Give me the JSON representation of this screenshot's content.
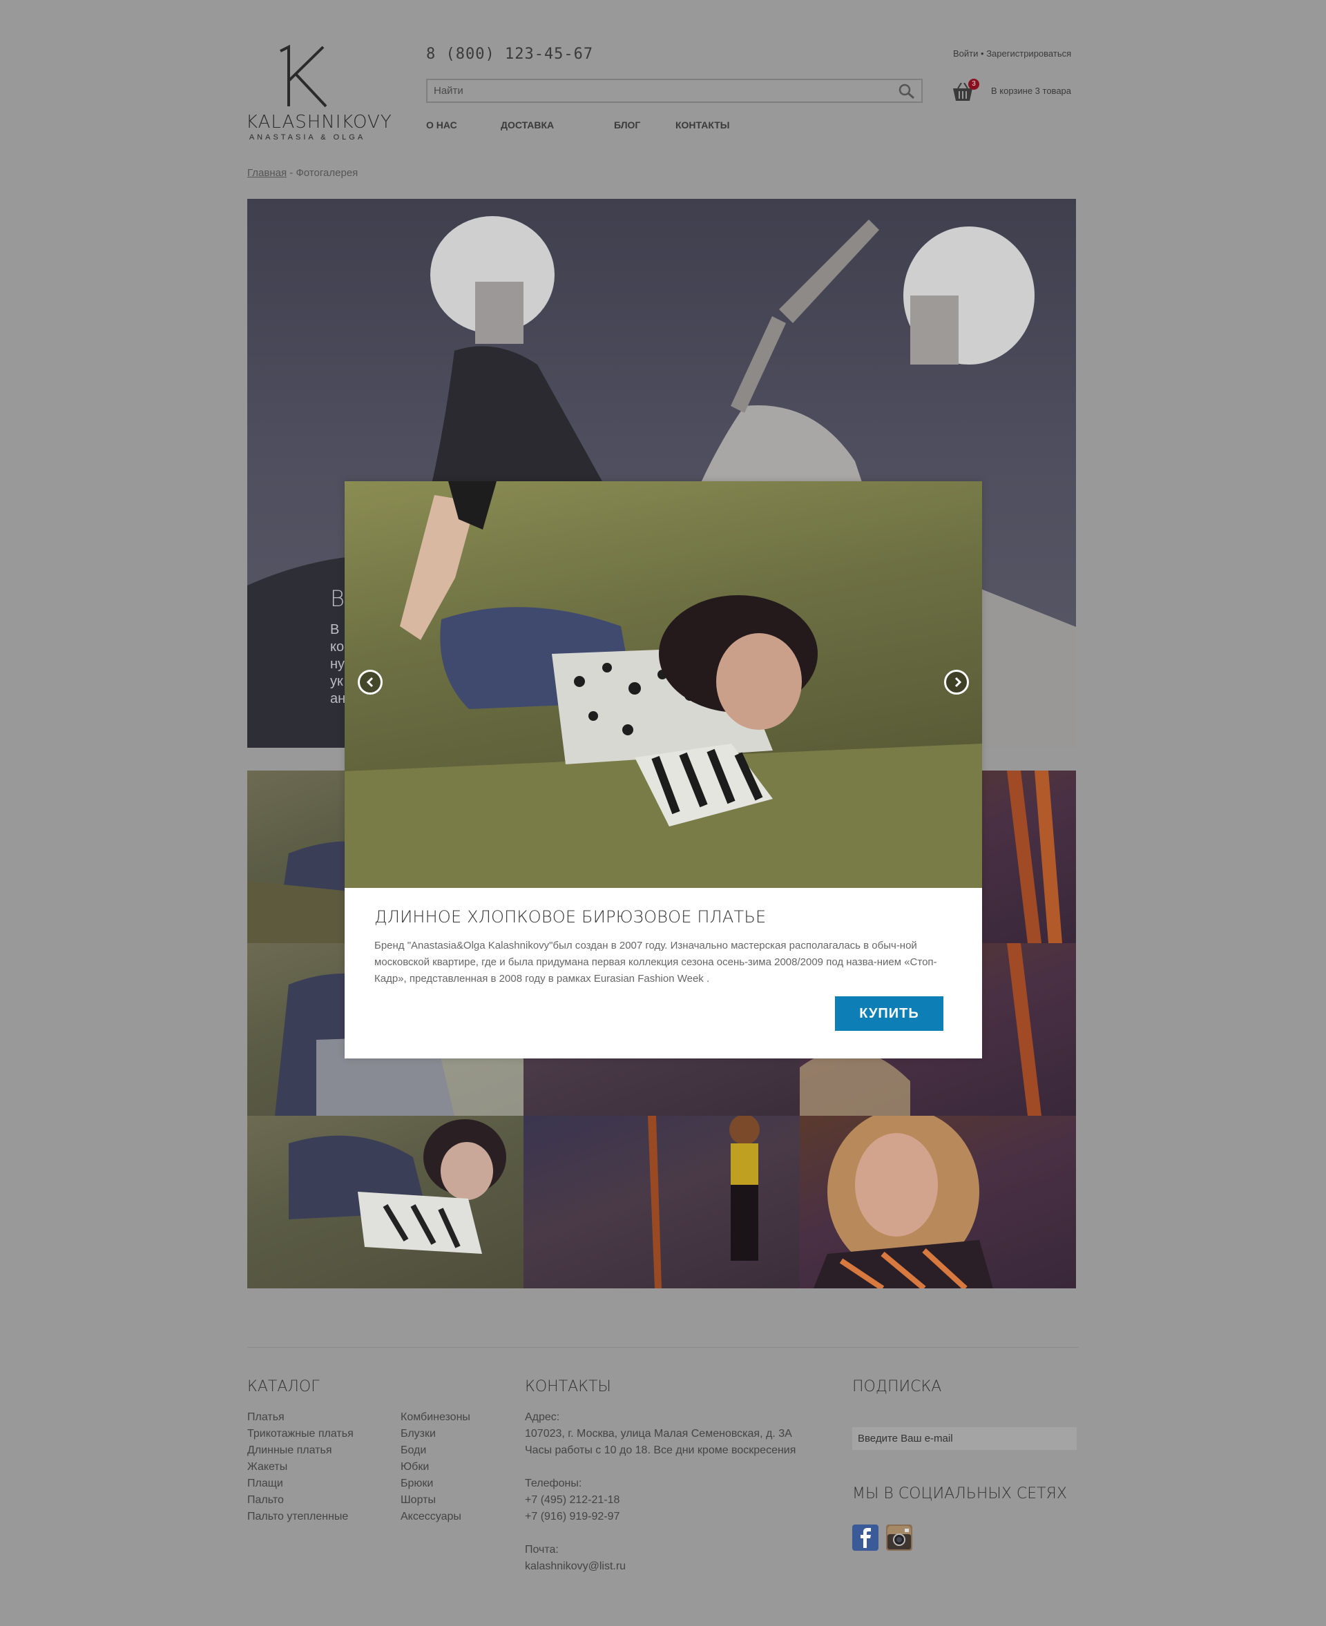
{
  "header": {
    "logo_name": "KALASHNIKOVY",
    "logo_sub": "ANASTASIA & OLGA",
    "phone": "8 (800) 123-45-67",
    "search_placeholder": "Найти",
    "login": "Войти",
    "separator": "•",
    "register": "Зарегистрироваться",
    "cart_count": "3",
    "cart_text": "В корзине 3 товара",
    "nav": [
      "О НАС",
      "ДОСТАВКА",
      "БЛОГ",
      "КОНТАКТЫ"
    ]
  },
  "breadcrumb": {
    "home": "Главная",
    "separator": "-",
    "current": "Фотогалерея"
  },
  "hero": {
    "heading_fragment": "В",
    "text_lines": [
      "В",
      "ко",
      "ну",
      "ук",
      "ан"
    ]
  },
  "modal": {
    "title": "ДЛИННОЕ ХЛОПКОВОЕ БИРЮЗОВОЕ ПЛАТЬЕ",
    "description": "Бренд  \"Anastasia&Olga Kalashnikovy\"был создан  в 2007 году. Изначально мастерская располагалась в обыч-ной московской квартире, где и была придумана первая коллекция сезона осень-зима 2008/2009 под назва-нием «Стоп-Кадр», представленная в 2008 году в рамках Eurasian Fashion Week .",
    "buy_label": "КУПИТЬ"
  },
  "footer": {
    "catalog": {
      "heading": "КАТАЛОГ",
      "col1": [
        "Платья",
        "Трикотажные платья",
        "Длинные платья",
        "Жакеты",
        "Плащи",
        "Пальто",
        "Пальто утепленные"
      ],
      "col2": [
        "Комбинезоны",
        "Блузки",
        "Боди",
        "Юбки",
        "Брюки",
        "Шорты",
        "Аксессуары"
      ]
    },
    "contacts": {
      "heading": "КОНТАКТЫ",
      "address_label": "Адрес:",
      "address_line1": "107023, г. Москва, улица Малая Семеновская, д. 3А",
      "address_line2": "Часы работы с 10 до 18. Все дни кроме воскресения",
      "phones_label": "Телефоны:",
      "phone1": "+7 (495) 212-21-18",
      "phone2": "+7 (916) 919-92-97",
      "mail_label": "Почта:",
      "mail": "kalashnikovy@list.ru"
    },
    "subscribe": {
      "heading": "ПОДПИСКА",
      "email_placeholder": "Введите Ваш e-mail",
      "social_heading": "МЫ В СОЦИАЛЬНЫХ СЕТЯХ",
      "icons": [
        "facebook-icon",
        "instagram-icon"
      ]
    }
  },
  "colors": {
    "background": "#999999",
    "buy_button": "#0d7fb6",
    "cart_badge": "#8a0f1f"
  }
}
